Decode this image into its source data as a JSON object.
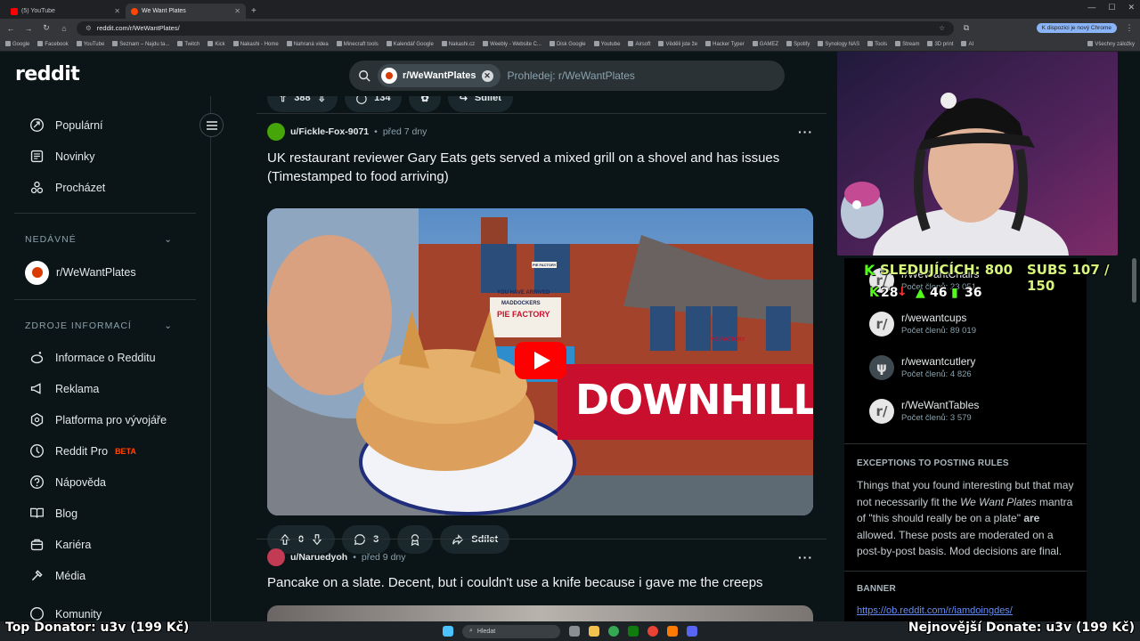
{
  "browser": {
    "tabs": [
      {
        "label": "(5) YouTube",
        "active": false
      },
      {
        "label": "We Want Plates",
        "active": true
      }
    ],
    "url": "reddit.com/r/WeWantPlates/",
    "update_badge": "K dispozici je nový Chrome",
    "bookmarks": [
      "Google",
      "Facebook",
      "YouTube",
      "Seznam – Najdu ta...",
      "Twitch",
      "Kick",
      "Nakashi - Home",
      "Nahraná videa",
      "Minecraft tools",
      "Kalendář Google",
      "Nakashi.cz",
      "Weebly - Website C...",
      "Disk Google",
      "Youtube",
      "Airsoft",
      "Věděli jste že",
      "Hacker Typer",
      "GAMEZ",
      "Spotify",
      "Synology NAS",
      "Tools",
      "Stream",
      "3D print",
      "AI",
      "Všechny záložky"
    ]
  },
  "header": {
    "logo": "reddit",
    "search_chip": "r/WeWantPlates",
    "search_placeholder": "Prohledej: r/WeWantPlates"
  },
  "sidebar": {
    "main_items": [
      {
        "label": "Populární",
        "icon": "popular-icon"
      },
      {
        "label": "Novinky",
        "icon": "news-icon"
      },
      {
        "label": "Procházet",
        "icon": "explore-icon"
      }
    ],
    "recent_header": "NEDÁVNÉ",
    "recent_items": [
      {
        "label": "r/WeWantPlates"
      }
    ],
    "resources_header": "ZDROJE INFORMACÍ",
    "resource_items": [
      {
        "label": "Informace o Redditu",
        "icon": "reddit-info-icon"
      },
      {
        "label": "Reklama",
        "icon": "megaphone-icon"
      },
      {
        "label": "Platforma pro vývojáře",
        "icon": "developer-icon"
      },
      {
        "label": "Reddit Pro",
        "icon": "reddit-pro-icon",
        "badge": "BETA"
      },
      {
        "label": "Nápověda",
        "icon": "help-icon"
      },
      {
        "label": "Blog",
        "icon": "blog-icon"
      },
      {
        "label": "Kariéra",
        "icon": "career-icon"
      },
      {
        "label": "Média",
        "icon": "media-icon"
      },
      {
        "label": "Komunity",
        "icon": "communities-icon"
      }
    ]
  },
  "feed": {
    "prev_actions": {
      "votes": "388",
      "comments": "134",
      "share": "Sdílet"
    },
    "post1": {
      "user": "u/Fickle-Fox-9071",
      "time": "před 7 dny",
      "title": "UK restaurant reviewer Gary Eats gets served a mixed grill on a shovel and has issues (Timestamped to food arriving)",
      "thumb_text": "DOWNHILL!",
      "sign_top": "YOU HAVE ARRIVED",
      "sign_mid": "MADDOCKERS",
      "sign_main": "PIE FACTORY",
      "sign_left": "PIE FACTORY",
      "sign_right": "PIE FACTORY",
      "votes": "0",
      "comments": "3",
      "share": "Sdílet"
    },
    "post2": {
      "user": "u/Naruedyoh",
      "time": "před 9 dny",
      "title": "Pancake on a slate. Decent, but i couldn't use a knife because i gave me the creeps"
    }
  },
  "right_sidebar": {
    "related": [
      {
        "name": "r/WeWantChairs",
        "members": "Počet členů: 23 051",
        "icon": "r/"
      },
      {
        "name": "r/wewantcups",
        "members": "Počet členů: 89 019",
        "icon": "r/"
      },
      {
        "name": "r/wewantcutlery",
        "members": "Počet členů: 4 826",
        "icon": "fork"
      },
      {
        "name": "r/WeWantTables",
        "members": "Počet členů: 3 579",
        "icon": "r/"
      }
    ],
    "exceptions_header": "EXCEPTIONS TO POSTING RULES",
    "exceptions_p1": "Things that you found interesting but that may not necessarily fit the ",
    "exceptions_em": "We Want Plates",
    "exceptions_p2": " mantra of \"this should really be on a plate\" ",
    "exceptions_bold": "are",
    "exceptions_p3": " allowed. These posts are moderated on a post-by-post basis. Mod decisions are final.",
    "banner_header": "BANNER",
    "banner_link": "https://ob.reddit.com/r/iamdoingdes/"
  },
  "stream_overlay": {
    "followers": "SLEDUJÍCÍCH: 800",
    "subs": "SUBS 107 / 150",
    "kick_count": "28",
    "trend_count": "46",
    "viewers": "36",
    "top_donator": "Top Donator: u3v (199 Kč)",
    "latest_donate": "Nejnovější Donate: u3v (199 Kč)"
  },
  "taskbar": {
    "search": "Hledat"
  }
}
